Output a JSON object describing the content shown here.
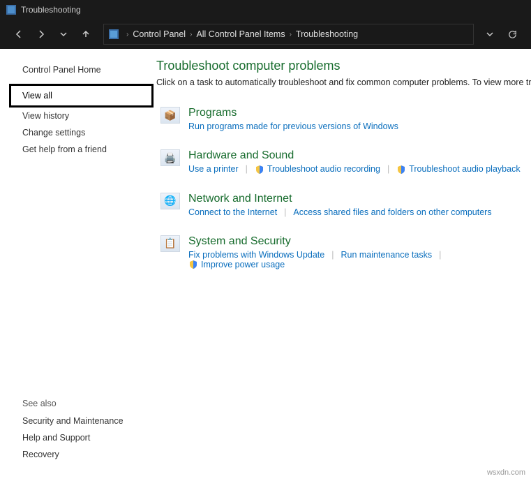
{
  "window": {
    "title": "Troubleshooting"
  },
  "breadcrumb": {
    "items": [
      "Control Panel",
      "All Control Panel Items",
      "Troubleshooting"
    ]
  },
  "sidebar": {
    "home": "Control Panel Home",
    "links": [
      "View all",
      "View history",
      "Change settings",
      "Get help from a friend"
    ]
  },
  "see_also": {
    "header": "See also",
    "links": [
      "Security and Maintenance",
      "Help and Support",
      "Recovery"
    ]
  },
  "main": {
    "title": "Troubleshoot computer problems",
    "subtitle": "Click on a task to automatically troubleshoot and fix common computer problems. To view more troubleshooters..."
  },
  "categories": [
    {
      "icon": "📦",
      "title": "Programs",
      "subs": [
        {
          "label": "Run programs made for previous versions of Windows",
          "shield": false
        }
      ]
    },
    {
      "icon": "🖨️",
      "title": "Hardware and Sound",
      "subs": [
        {
          "label": "Use a printer",
          "shield": false
        },
        {
          "label": "Troubleshoot audio recording",
          "shield": true
        },
        {
          "label": "Troubleshoot audio playback",
          "shield": true
        }
      ]
    },
    {
      "icon": "🌐",
      "title": "Network and Internet",
      "subs": [
        {
          "label": "Connect to the Internet",
          "shield": false
        },
        {
          "label": "Access shared files and folders on other computers",
          "shield": false
        }
      ]
    },
    {
      "icon": "📋",
      "title": "System and Security",
      "subs": [
        {
          "label": "Fix problems with Windows Update",
          "shield": false
        },
        {
          "label": "Run maintenance tasks",
          "shield": false
        },
        {
          "label": "Improve power usage",
          "shield": true
        }
      ]
    }
  ],
  "watermark": "wsxdn.com"
}
